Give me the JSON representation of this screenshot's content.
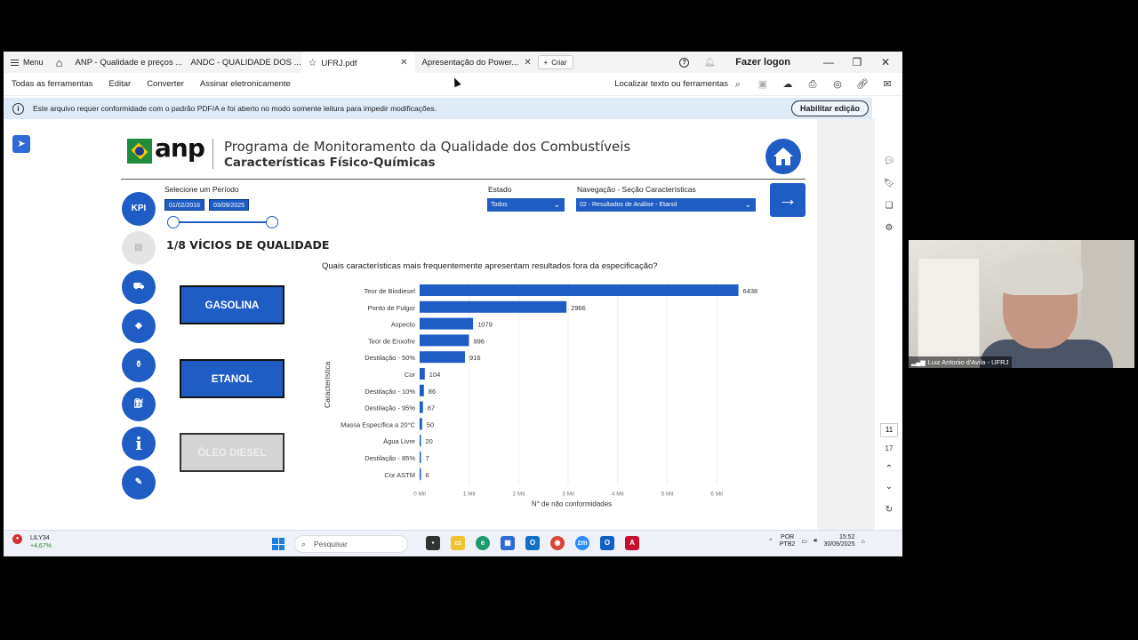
{
  "browser": {
    "menu_label": "Menu",
    "tabs": [
      {
        "label": "ANP - Qualidade e preços ..."
      },
      {
        "label": "ANDC - QUALIDADE DOS ..."
      },
      {
        "label": "UFRJ.pdf"
      },
      {
        "label": "Apresentação do Power..."
      }
    ],
    "new_tab_label": "Criar",
    "login_label": "Fazer logon"
  },
  "toolbar": {
    "items": [
      "Todas as ferramentas",
      "Editar",
      "Converter",
      "Assinar eletronicamente"
    ],
    "search_label": "Localizar texto ou ferramentas"
  },
  "infobar": {
    "message": "Este arquivo requer conformidade com o padrão PDF/A e foi aberto no modo somente leitura para impedir modificações.",
    "button_label": "Habilitar edição"
  },
  "pager": {
    "current": "11",
    "total": "17"
  },
  "report": {
    "title_line1": "Programa de Monitoramento da Qualidade dos Combustíveis",
    "title_line2": "Características Físico-Químicas",
    "logo_text": "anp",
    "period_label": "Selecione um Período",
    "date_start": "01/02/2016",
    "date_end": "03/09/2025",
    "estado_label": "Estado",
    "estado_value": "Todos",
    "nav_label": "Navegação - Seção Características",
    "nav_value": "02 - Resultados de Análise - Etanol",
    "section_title": "1/8 VÍCIOS DE QUALIDADE",
    "side_icons": [
      "kpi-icon",
      "clipboard-icon",
      "truck-icon",
      "brazil-map-icon",
      "flask-icon",
      "fuel-pump-icon",
      "info-icon",
      "notes-icon"
    ],
    "kpi_label": "KPI",
    "fuel_buttons": [
      "GASOLINA",
      "ETANOL",
      "ÓLEO DIESEL"
    ]
  },
  "chart_data": {
    "type": "bar",
    "orientation": "horizontal",
    "title": "Quais características mais frequentemente apresentam resultados fora da especificação?",
    "xlabel": "N° de não conformidades",
    "ylabel": "Característica",
    "categories": [
      "Teor de Biodiesel",
      "Ponto de Fulgor",
      "Aspecto",
      "Teor de Enxofre",
      "Destilação - 50%",
      "Cor",
      "Destilação - 10%",
      "Destilação - 95%",
      "Massa Específica a 20°C",
      "Água Livre",
      "Destilação - 85%",
      "Cor ASTM"
    ],
    "values": [
      6438,
      2966,
      1079,
      996,
      916,
      104,
      86,
      67,
      50,
      20,
      7,
      6
    ],
    "xticks": [
      "0 Mil",
      "1 Mil",
      "2 Mil",
      "3 Mil",
      "4 Mil",
      "5 Mil",
      "6 Mil"
    ],
    "xlim": [
      0,
      6500
    ],
    "bar_color": "#1f5cc4",
    "grid": true
  },
  "taskbar": {
    "stock_name": "LILY34",
    "stock_change": "+4,67%",
    "search_placeholder": "Pesquisar",
    "lang_line1": "POR",
    "lang_line2": "PTB2",
    "time": "15:52",
    "date": "30/09/2025"
  },
  "webcam": {
    "participant_name": "Luiz Antonio d'Avila - UFRJ"
  },
  "colors": {
    "accent": "#1f5cc4",
    "info_bar": "#dfeaf7"
  }
}
